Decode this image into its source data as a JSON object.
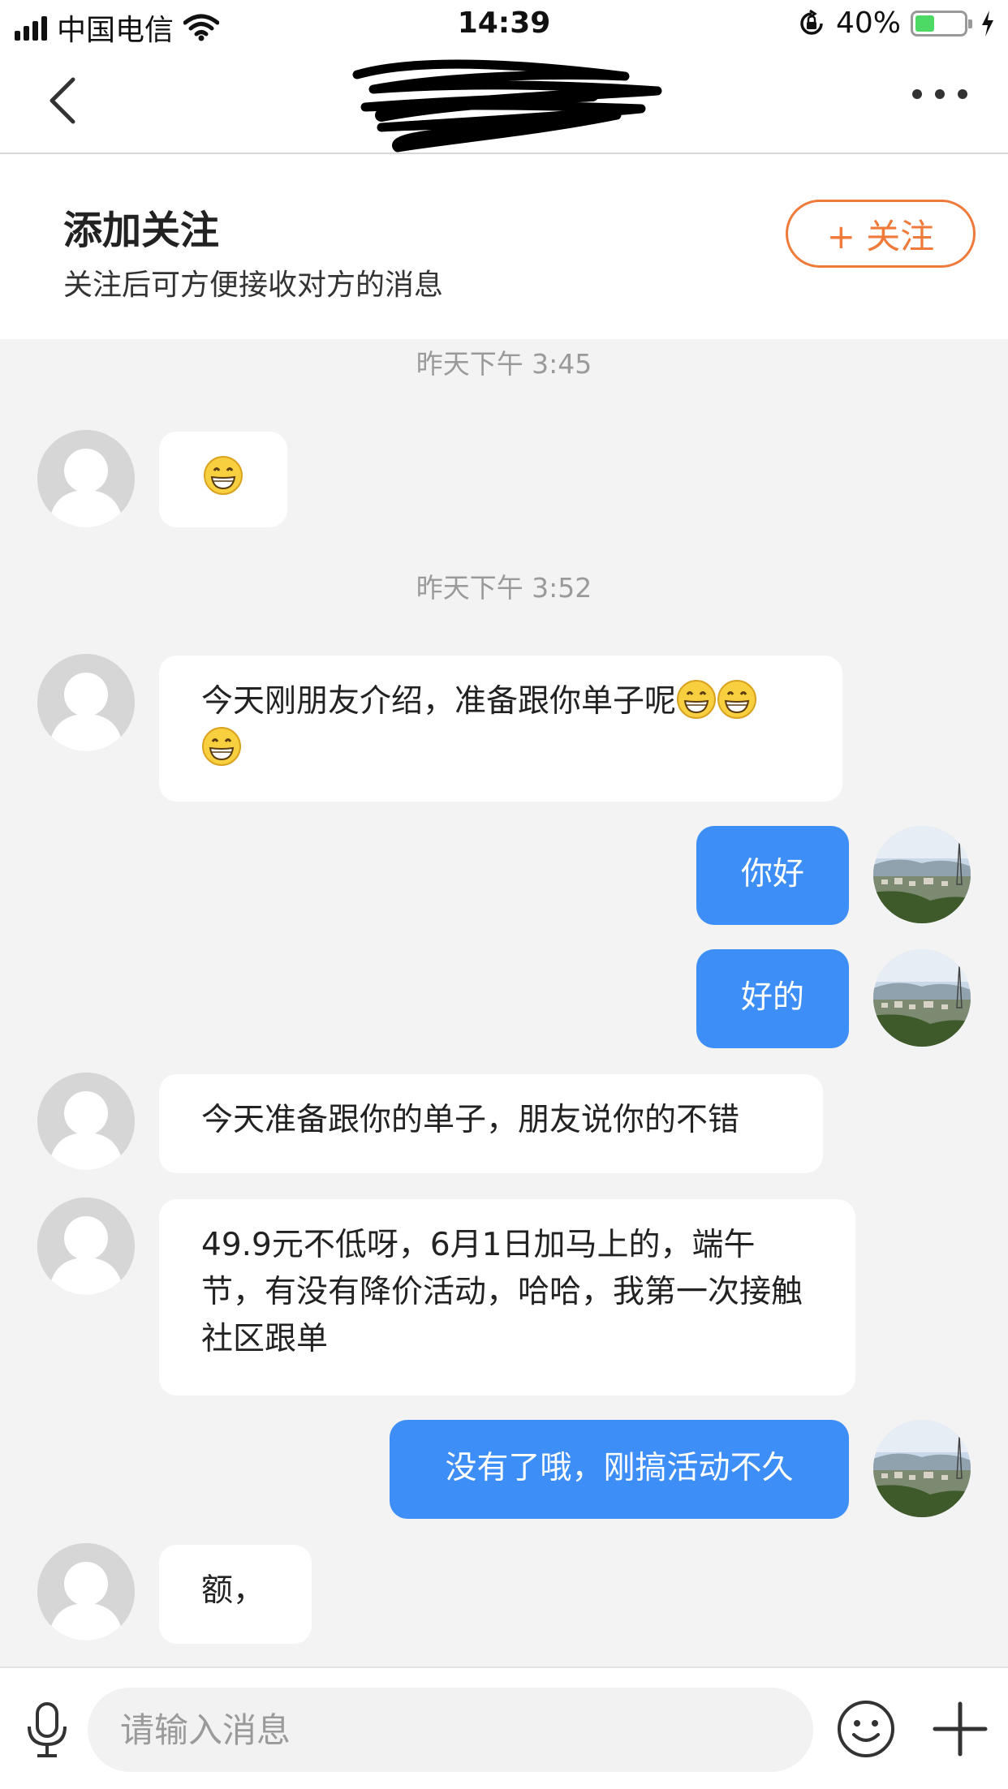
{
  "status_bar": {
    "carrier": "中国电信",
    "time": "14:39",
    "battery_percent": "40%",
    "battery_level": 0.4,
    "battery_color": "#4cd964",
    "icons": [
      "signal-icon",
      "wifi-icon",
      "orientation-lock-icon",
      "battery-icon",
      "charging-icon"
    ]
  },
  "nav": {
    "title_redacted": true,
    "icons": [
      "back-icon",
      "more-icon"
    ]
  },
  "follow_banner": {
    "title": "添加关注",
    "subtitle": "关注后可方便接收对方的消息",
    "button_label": "+ 关注",
    "accent_color": "#f07a3a"
  },
  "chat": {
    "outgoing_color": "#3d8ef7",
    "timestamps": [
      "昨天下午 3:45",
      "昨天下午 3:52"
    ],
    "messages": [
      {
        "from": "other",
        "text": "",
        "emoji_count": 1
      },
      {
        "from": "other",
        "text": "今天刚朋友介绍，准备跟你单子呢",
        "emoji_count": 3
      },
      {
        "from": "me",
        "text": "你好"
      },
      {
        "from": "me",
        "text": "好的"
      },
      {
        "from": "other",
        "text": "今天准备跟你的单子，朋友说你的不错"
      },
      {
        "from": "other",
        "text": "49.9元不低呀，6月1日加马上的，端午节，有没有降价活动，哈哈，我第一次接触社区跟单"
      },
      {
        "from": "me",
        "text": "没有了哦，刚搞活动不久"
      },
      {
        "from": "other",
        "text": "额，"
      }
    ]
  },
  "input_bar": {
    "placeholder": "请输入消息",
    "icons": [
      "microphone-icon",
      "emoji-icon",
      "plus-icon"
    ]
  }
}
